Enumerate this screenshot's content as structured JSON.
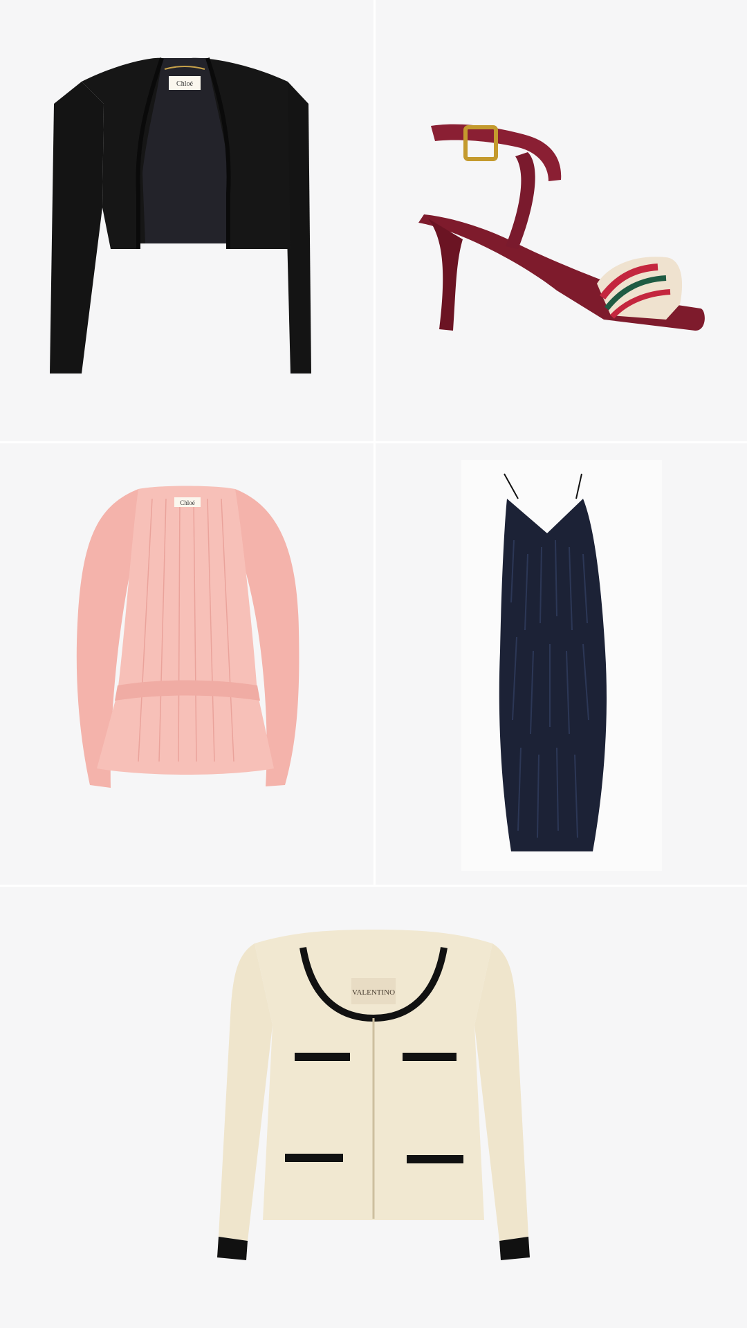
{
  "products": [
    {
      "name": "cropped-black-jacket",
      "brand_label": "Chloé",
      "color": "#141414"
    },
    {
      "name": "burgundy-strappy-sandal",
      "color": "#7e1b2c"
    },
    {
      "name": "pink-pleated-mini-dress",
      "brand_label": "Chloé",
      "color": "#f4b7b0"
    },
    {
      "name": "navy-fringed-slip-dress",
      "color": "#1c2236"
    },
    {
      "name": "cream-tweed-jacket",
      "brand_label": "VALENTINO",
      "color": "#efe5cc"
    }
  ],
  "colors": {
    "tile_background": "#f6f6f7",
    "divider": "#ffffff"
  }
}
